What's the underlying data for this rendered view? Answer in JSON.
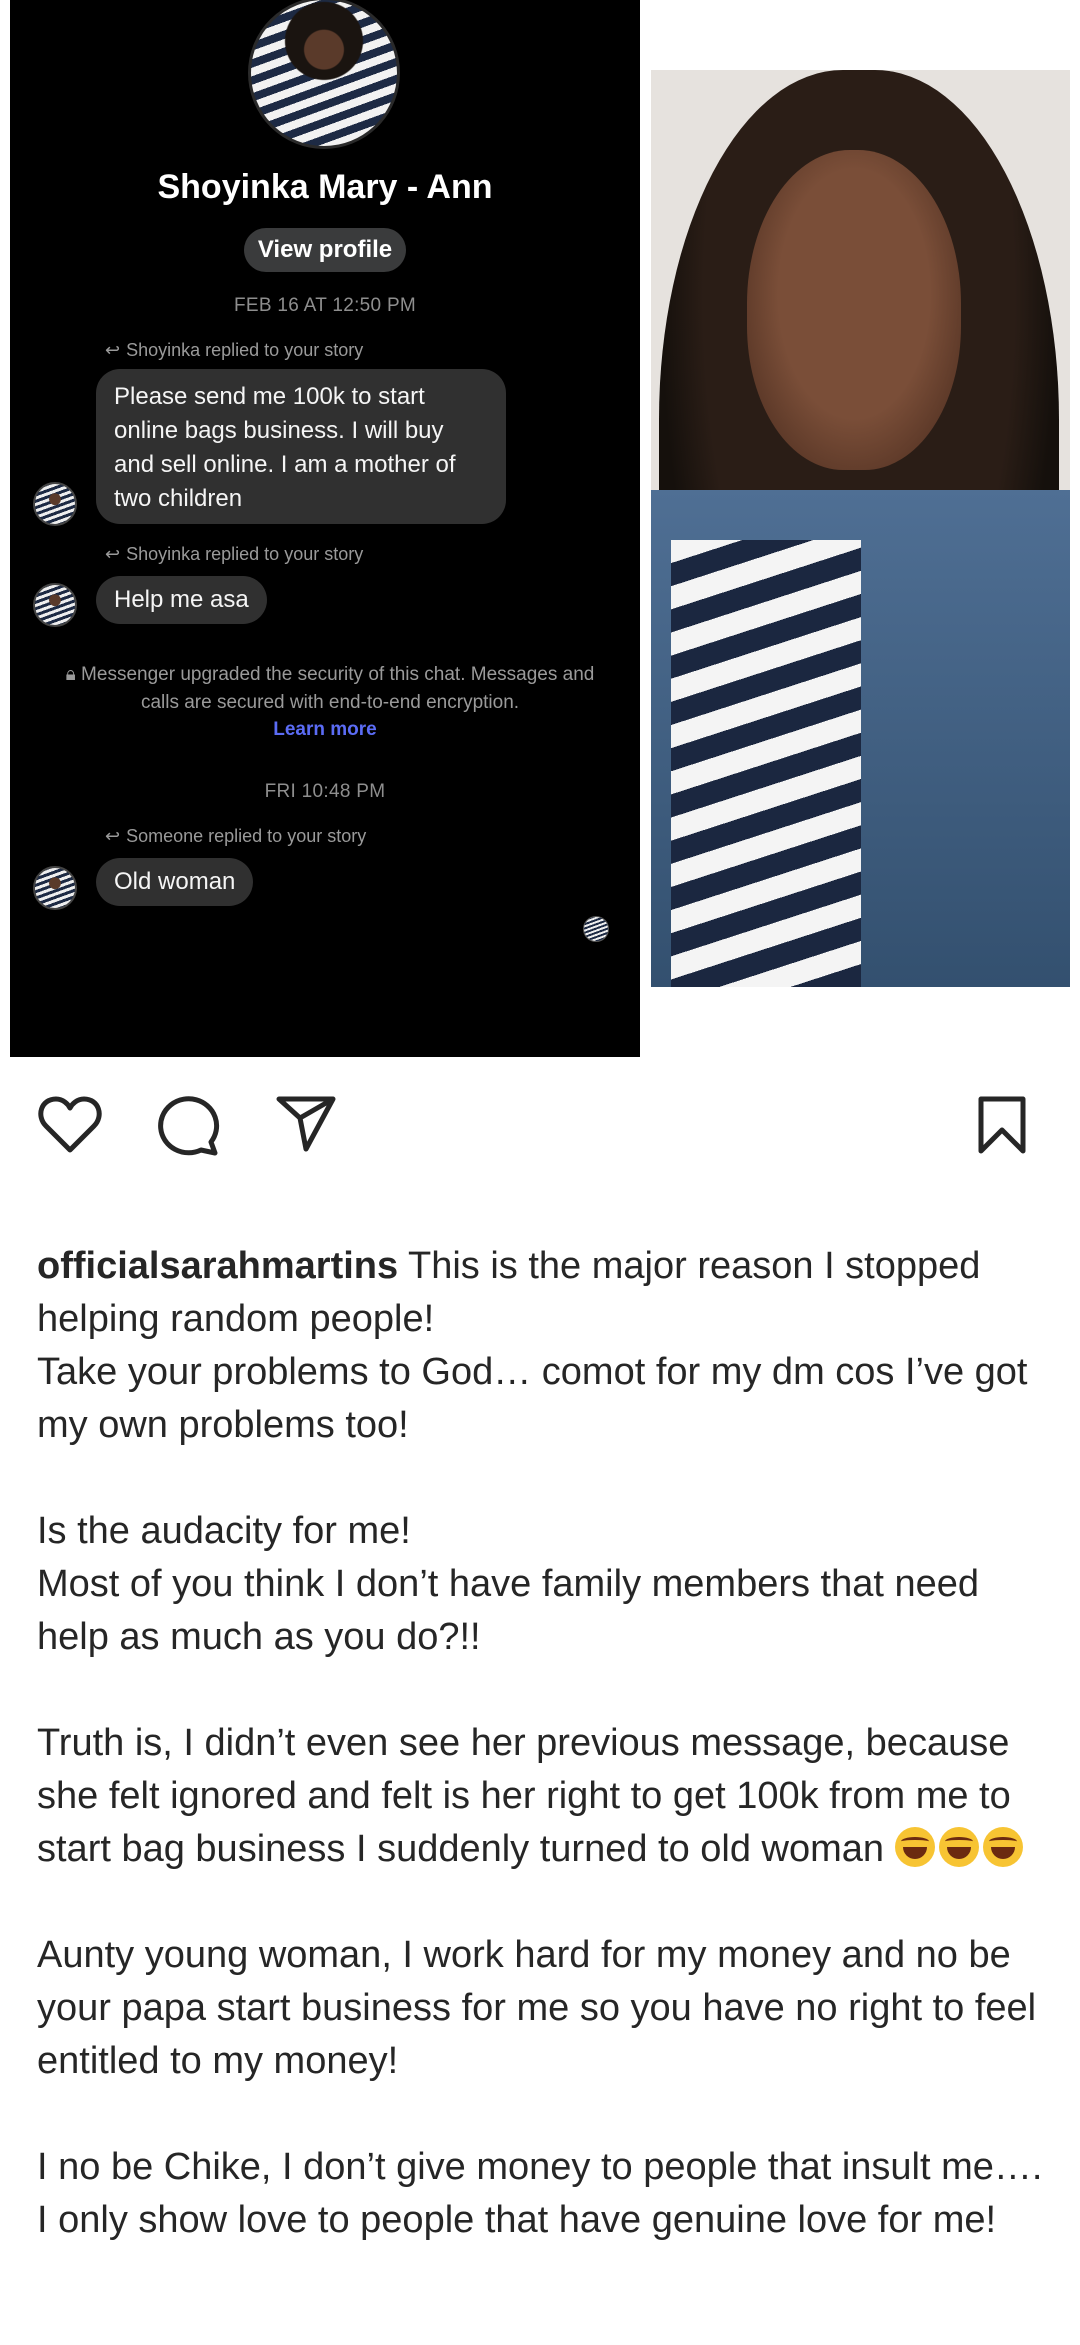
{
  "chat": {
    "profile_name": "Shoyinka Mary - Ann",
    "view_profile_label": "View profile",
    "timestamp_1": "FEB 16 AT 12:50 PM",
    "reply_note_1": "Shoyinka replied to your story",
    "message_1": "Please send me 100k to start online bags business. I will buy and sell online. I am a mother of two children",
    "reply_note_2": "Shoyinka replied to your story",
    "message_2": "Help me asa",
    "security_note": "Messenger upgraded the security of this chat. Messages and calls are secured with end-to-end encryption.",
    "learn_more_label": "Learn more",
    "timestamp_2": "FRI 10:48 PM",
    "reply_note_3": "Someone replied to your story",
    "message_3": "Old woman"
  },
  "icons": {
    "like": "heart-icon",
    "comment": "comment-icon",
    "share": "send-icon",
    "save": "bookmark-icon",
    "lock": "lock-icon",
    "reply": "reply-arrow-icon"
  },
  "caption": {
    "username": "officialsarahmartins",
    "line_1": "This is the major reason I stopped helping random people!",
    "line_2": "Take your problems to God… comot for my dm cos I’ve got my own problems too!",
    "line_3": "Is the audacity for me!",
    "line_4": "Most of you think I don’t have family members that need help as much as you do?!!",
    "line_5": "Truth is, I didn’t even see her previous message, because she felt ignored and felt is her right to get 100k from me to start bag business I suddenly turned to old woman",
    "line_6": "Aunty young woman, I work hard for my money and no be your papa start business for me so you have no right to feel entitled to my money!",
    "line_7": "I no be Chike, I don’t give money to people that insult me…. I only show love to people that have genuine love for me!"
  },
  "colors": {
    "chat_background": "#000000",
    "bubble": "#303030",
    "link_blue": "#5b6cf5",
    "text_dark": "#262626"
  }
}
